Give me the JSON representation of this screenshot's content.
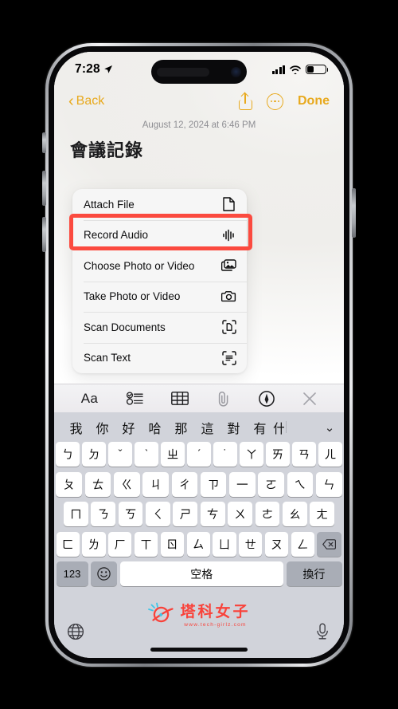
{
  "status_bar": {
    "time": "7:28",
    "location_icon": "location-arrow-icon",
    "signal_icon": "cellular-signal-icon",
    "wifi_icon": "wifi-icon",
    "battery_icon": "battery-low-icon"
  },
  "nav": {
    "back_label": "Back",
    "back_icon": "chevron-left-icon",
    "share_icon": "share-icon",
    "more_icon": "more-ellipsis-circle-icon",
    "done_label": "Done",
    "accent_color": "#E8A91D"
  },
  "note": {
    "date": "August 12, 2024 at 6:46 PM",
    "title": "會議記錄"
  },
  "attach_menu": {
    "items": [
      {
        "label": "Attach File",
        "icon": "document-icon"
      },
      {
        "label": "Record Audio",
        "icon": "audio-waveform-icon",
        "highlighted": true
      },
      {
        "label": "Choose Photo or Video",
        "icon": "photo-library-icon"
      },
      {
        "label": "Take Photo or Video",
        "icon": "camera-icon"
      },
      {
        "label": "Scan Documents",
        "icon": "scan-document-icon"
      },
      {
        "label": "Scan Text",
        "icon": "scan-text-icon"
      }
    ]
  },
  "annotation": {
    "highlight_color": "#FB4A3F",
    "target": "Record Audio"
  },
  "format_toolbar": {
    "items": [
      {
        "name": "text-format-button",
        "label": "Aa",
        "icon": "aa-icon"
      },
      {
        "name": "checklist-button",
        "label": "",
        "icon": "checklist-icon"
      },
      {
        "name": "table-button",
        "label": "",
        "icon": "table-icon"
      },
      {
        "name": "attachment-button",
        "label": "",
        "icon": "paperclip-icon"
      },
      {
        "name": "markup-button",
        "label": "",
        "icon": "markup-pen-icon"
      },
      {
        "name": "close-toolbar-button",
        "label": "",
        "icon": "close-x-icon"
      }
    ]
  },
  "keyboard": {
    "suggestions": [
      "我",
      "你",
      "好",
      "哈",
      "那",
      "這",
      "對",
      "有"
    ],
    "suggestion_clipped": "什",
    "collapse_icon": "chevron-down-icon",
    "row1": [
      "ㄅ",
      "ㄉ",
      "ˇ",
      "ˋ",
      "ㄓ",
      "ˊ",
      "˙",
      "ㄚ",
      "ㄞ",
      "ㄢ",
      "ㄦ"
    ],
    "row2": [
      "ㄆ",
      "ㄊ",
      "ㄍ",
      "ㄐ",
      "ㄔ",
      "ㄗ",
      "一",
      "ㄛ",
      "ㄟ",
      "ㄣ"
    ],
    "row3": [
      "ㄇ",
      "ㄋ",
      "ㄎ",
      "ㄑ",
      "ㄕ",
      "ㄘ",
      "ㄨ",
      "ㄜ",
      "ㄠ",
      "ㄤ"
    ],
    "row4": [
      "ㄈ",
      "ㄌ",
      "ㄏ",
      "ㄒ",
      "ㄖ",
      "ㄙ",
      "ㄩ",
      "ㄝ",
      "ㄡ",
      "ㄥ"
    ],
    "backspace_icon": "delete-backward-icon",
    "numeric_key": "123",
    "emoji_key_icon": "emoji-smiley-icon",
    "space_key": "空格",
    "return_key": "換行",
    "globe_icon": "globe-keyboard-switch-icon",
    "mic_icon": "microphone-dictation-icon"
  },
  "watermark": {
    "brand": "塔科女子",
    "url": "www.tech-girlz.com",
    "logo_icon": "planet-logo-icon",
    "color": "#F9423A"
  }
}
